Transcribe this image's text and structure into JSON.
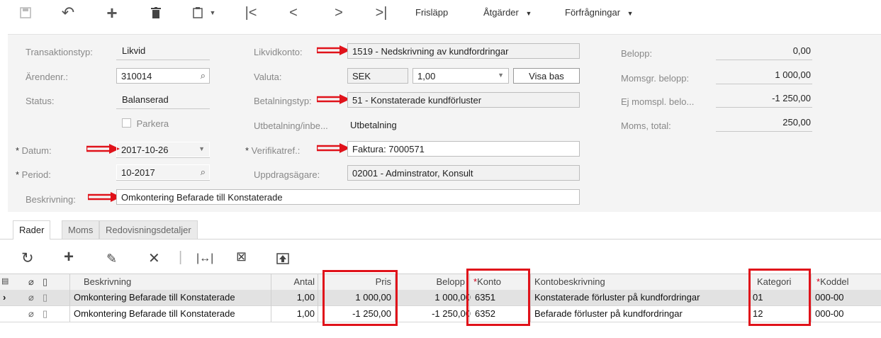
{
  "toolbar": {
    "actions": [
      {
        "name": "save-icon",
        "glyph": "💾"
      },
      {
        "name": "undo-icon",
        "glyph": "↶"
      },
      {
        "name": "add-icon",
        "glyph": "+"
      },
      {
        "name": "delete-icon",
        "glyph": "🗑"
      },
      {
        "name": "copy-paste-icon",
        "glyph": "⧉"
      },
      {
        "name": "first-record-icon",
        "glyph": "|<"
      },
      {
        "name": "previous-record-icon",
        "glyph": "<"
      },
      {
        "name": "next-record-icon",
        "glyph": ">"
      },
      {
        "name": "last-record-icon",
        "glyph": ">|"
      }
    ],
    "release": "Frisläpp",
    "actions_menu": "Åtgärder",
    "inquiries_menu": "Förfrågningar"
  },
  "form": {
    "transaction_type": {
      "label": "Transaktionstyp:",
      "value": "Likvid"
    },
    "case_no": {
      "label": "Ärendenr.:",
      "value": "310014"
    },
    "status": {
      "label": "Status:",
      "value": "Balanserad"
    },
    "hold": {
      "label": "Parkera",
      "checked": false
    },
    "date": {
      "label": "Datum:",
      "value": "2017-10-26"
    },
    "period": {
      "label": "Period:",
      "value": "10-2017"
    },
    "description": {
      "label": "Beskrivning:",
      "value": "Omkontering Befarade till Konstaterade"
    },
    "cash_account": {
      "label": "Likvidkonto:",
      "value": "1519 - Nedskrivning av kundfordringar"
    },
    "currency": {
      "label": "Valuta:",
      "value": "SEK",
      "rate": "1,00",
      "view_base": "Visa bas"
    },
    "payment_method": {
      "label": "Betalningstyp:",
      "value": "51 - Konstaterade kundförluster"
    },
    "payment_receipt": {
      "label": "Utbetalning/inbe...",
      "value": "Utbetalning"
    },
    "voucher_ref": {
      "label": "Verifikatref.:",
      "value": "Faktura: 7000571"
    },
    "owner": {
      "label": "Uppdragsägare:",
      "value": "02001 - Adminstrator, Konsult"
    },
    "amount": {
      "label": "Belopp:",
      "value": "0,00"
    },
    "vat_taxable": {
      "label": "Momsgr. belopp:",
      "value": "1 000,00"
    },
    "vat_exempt": {
      "label": "Ej momspl. belo...",
      "value": "-1 250,00"
    },
    "vat_total": {
      "label": "Moms, total:",
      "value": "250,00"
    }
  },
  "tabs": [
    "Rader",
    "Moms",
    "Redovisningsdetaljer"
  ],
  "grid_toolbar": [
    {
      "name": "refresh-icon",
      "glyph": "C"
    },
    {
      "name": "add-row-icon",
      "glyph": "+"
    },
    {
      "name": "edit-icon",
      "glyph": "✎"
    },
    {
      "name": "delete-row-icon",
      "glyph": "✕"
    },
    {
      "name": "fit-width-icon",
      "glyph": "|↔|"
    },
    {
      "name": "export-excel-icon",
      "glyph": "⊠"
    },
    {
      "name": "upload-icon",
      "glyph": "⇪"
    }
  ],
  "grid": {
    "headers": {
      "description": "Beskrivning",
      "qty": "Antal",
      "price": "Pris",
      "amount": "Belopp",
      "account": "Konto",
      "account_desc": "Kontobeskrivning",
      "category": "Kategori",
      "subaccount": "Koddel"
    },
    "rows": [
      {
        "description": "Omkontering Befarade till Konstaterade",
        "qty": "1,00",
        "price": "1 000,00",
        "amount": "1 000,00",
        "account": "6351",
        "account_desc": "Konstaterade förluster på kundfordringar",
        "category": "01",
        "subaccount": "000-00"
      },
      {
        "description": "Omkontering Befarade till Konstaterade",
        "qty": "1,00",
        "price": "-1 250,00",
        "amount": "-1 250,00",
        "account": "6352",
        "account_desc": "Befarade förluster på kundfordringar",
        "category": "12",
        "subaccount": "000-00"
      }
    ]
  },
  "colors": {
    "highlight_red": "#e0121a",
    "form_bg": "#f4f4f4",
    "selected_row": "#e2e2e2"
  }
}
